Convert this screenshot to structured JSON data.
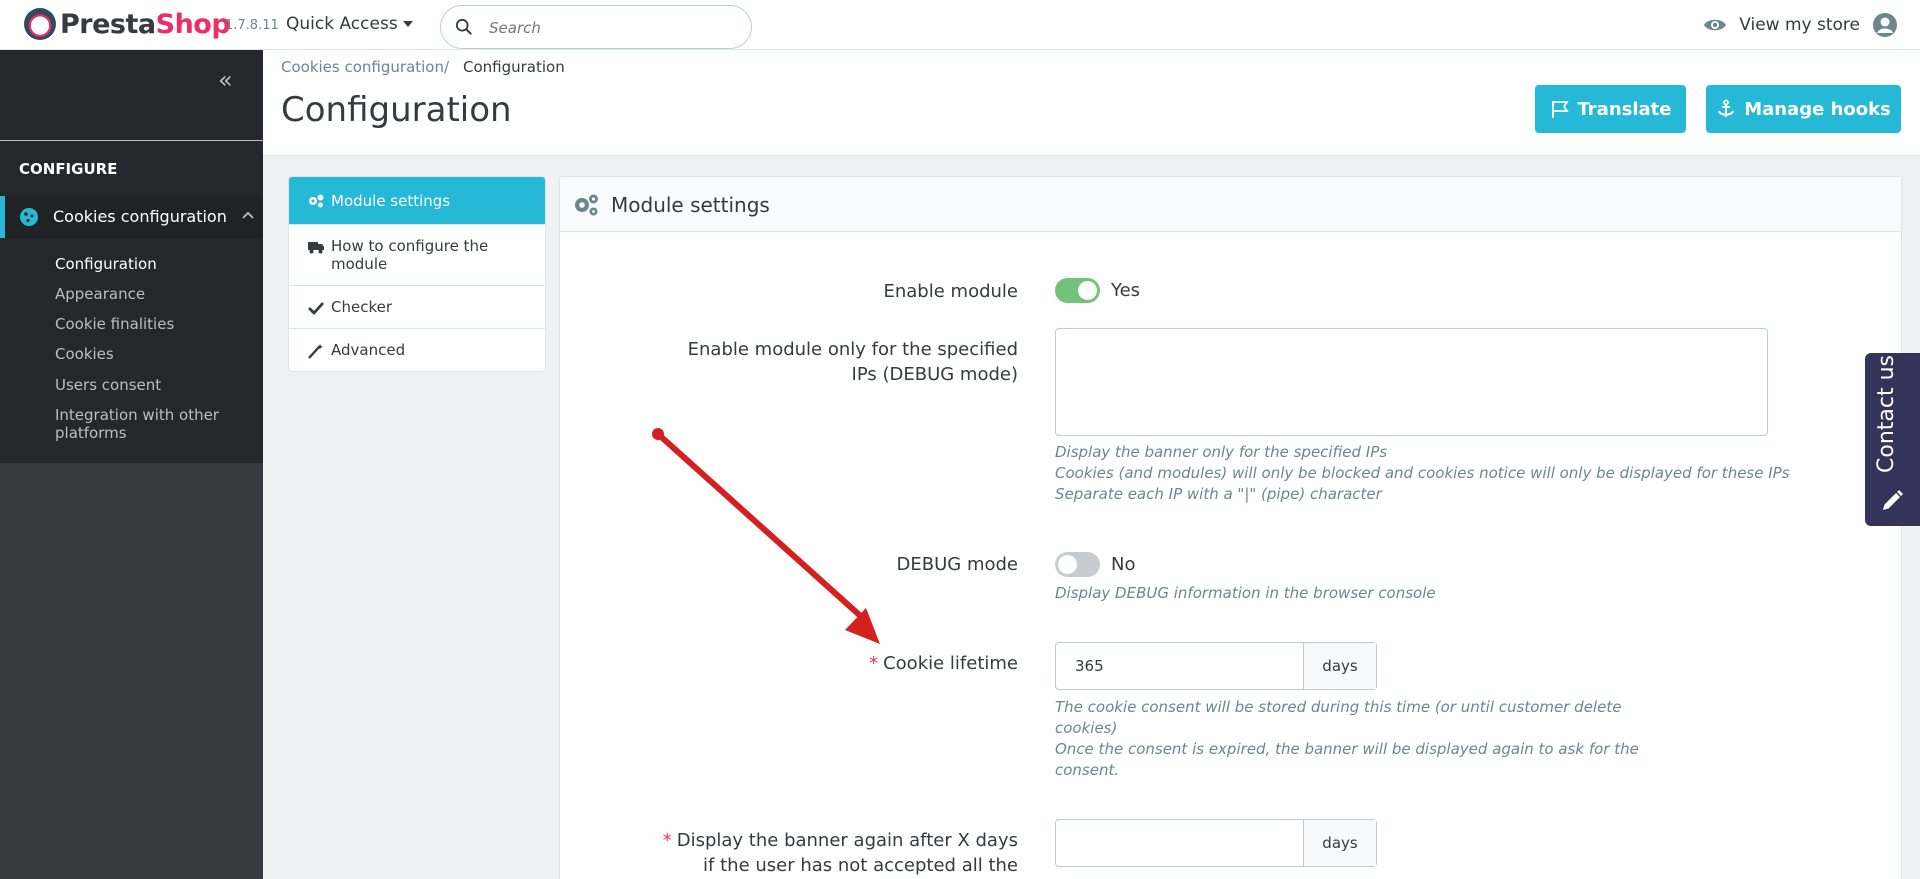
{
  "header": {
    "brand_pre": "Presta",
    "brand_post": "Shop",
    "version": "1.7.8.11",
    "quick_access": "Quick Access",
    "search_placeholder": "Search",
    "view_store": "View my store"
  },
  "sidebar": {
    "section_title": "CONFIGURE",
    "active_item": "Cookies configuration",
    "sub_items": [
      "Configuration",
      "Appearance",
      "Cookie finalities",
      "Cookies",
      "Users consent",
      "Integration with other",
      "platforms"
    ]
  },
  "page": {
    "breadcrumb_parent": "Cookies configuration",
    "breadcrumb_sep": "/",
    "breadcrumb_current": "Configuration",
    "title": "Configuration",
    "translate_label": "Translate",
    "hooks_label": "Manage hooks"
  },
  "tabs": [
    {
      "label": "Module settings",
      "icon": "gears-icon"
    },
    {
      "label": "How to configure the module",
      "icon": "truck-icon"
    },
    {
      "label": "Checker",
      "icon": "check-icon"
    },
    {
      "label": "Advanced",
      "icon": "magic-wand-icon"
    }
  ],
  "panel": {
    "title": "Module settings",
    "enable_module": {
      "label": "Enable module",
      "value": "Yes"
    },
    "debug_ips": {
      "label_line1": "Enable module only for the specified",
      "label_line2": "IPs (DEBUG mode)",
      "help": [
        "Display the banner only for the specified IPs",
        "Cookies (and modules) will only be blocked and cookies notice will only be displayed for these IPs",
        "Separate each IP with a \"|\" (pipe) character"
      ]
    },
    "debug_mode": {
      "label": "DEBUG mode",
      "value": "No",
      "help": "Display DEBUG information in the browser console"
    },
    "cookie_lifetime": {
      "required": "*",
      "label": "Cookie lifetime",
      "value": "365",
      "unit": "days",
      "help": [
        "The cookie consent will be stored during this time (or until customer delete",
        "cookies)",
        "Once the consent is expired, the banner will be displayed again to ask for the",
        "consent."
      ]
    },
    "banner_again": {
      "required": "*",
      "label_line1": "Display the banner again after X days",
      "label_line2": "if the user has not accepted all the",
      "value": "",
      "unit": "days"
    }
  },
  "contact": {
    "label": "Contact us"
  },
  "colors": {
    "accent": "#25b9d7",
    "sidebar": "#363a41",
    "switch_on": "#72c279",
    "brand": "#ef2d64"
  }
}
